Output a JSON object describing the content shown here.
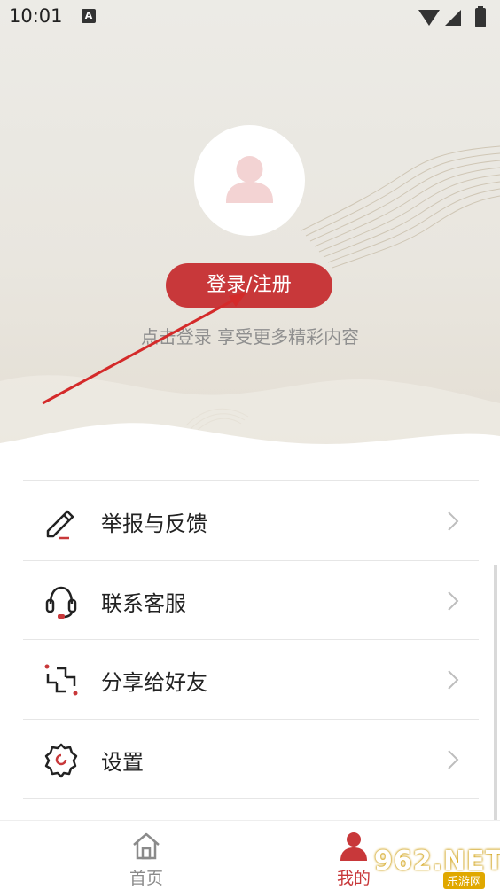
{
  "status_bar": {
    "time": "10:01",
    "notification_icon": "A"
  },
  "profile": {
    "avatar_icon": "person-icon",
    "login_label": "登录/注册",
    "subtitle": "点击登录 享受更多精彩内容"
  },
  "menu": {
    "items": [
      {
        "label": "举报与反馈",
        "icon": "pencil-icon"
      },
      {
        "label": "联系客服",
        "icon": "headset-icon"
      },
      {
        "label": "分享给好友",
        "icon": "share-icon"
      },
      {
        "label": "设置",
        "icon": "gear-icon"
      }
    ]
  },
  "bottom_nav": {
    "home_label": "首页",
    "mine_label": "我的"
  },
  "watermark": {
    "text": "962.NET",
    "sub": "乐游网"
  },
  "colors": {
    "accent": "#c8383a",
    "header_bg": "#e9e6df",
    "arrow_annotation": "#d42a2a"
  }
}
